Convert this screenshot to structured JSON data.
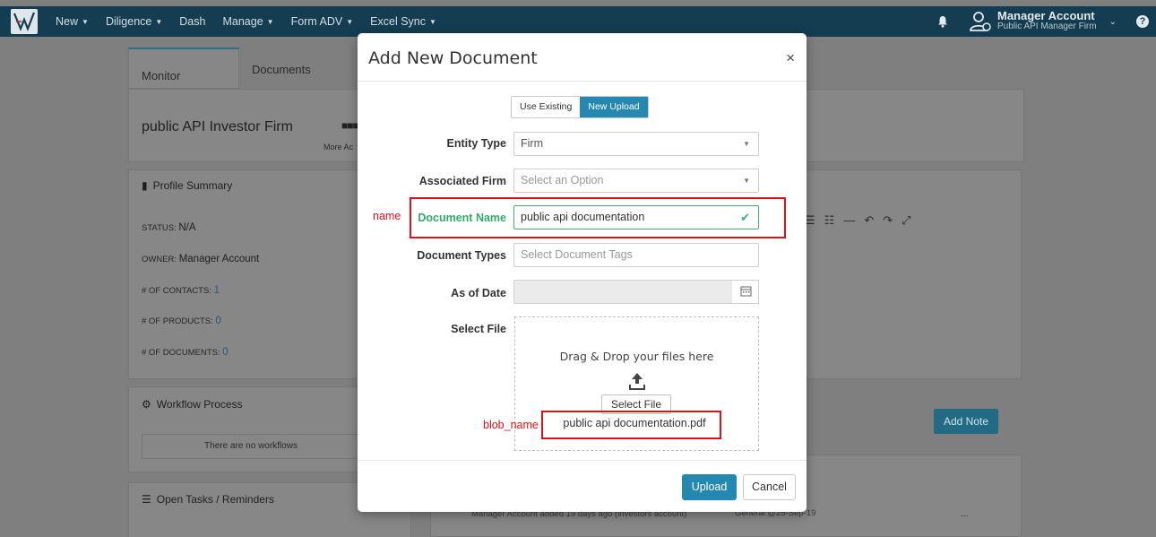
{
  "nav": {
    "items": [
      {
        "label": "New",
        "caret": true
      },
      {
        "label": "Diligence",
        "caret": true
      },
      {
        "label": "Dash",
        "caret": false
      },
      {
        "label": "Manage",
        "caret": true
      },
      {
        "label": "Form ADV",
        "caret": true
      },
      {
        "label": "Excel Sync",
        "caret": true
      }
    ],
    "account_name": "Manager Account",
    "account_firm": "Public API Manager Firm"
  },
  "background": {
    "tab_monitor": "Monitor",
    "tab_documents": "Documents",
    "firm_name": "public API Investor Firm",
    "more_actions": "More Ac",
    "profile_summary": "Profile Summary",
    "status_label": "STATUS:",
    "status_value": "N/A",
    "owner_label": "OWNER:",
    "owner_value": "Manager Account",
    "contacts_label": "# OF CONTACTS:",
    "contacts_value": "1",
    "products_label": "# OF PRODUCTS:",
    "products_value": "0",
    "documents_label": "# OF DOCUMENTS:",
    "documents_value": "0",
    "workflow_title": "Workflow Process",
    "no_workflows": "There are no workflows",
    "tasks_title": "Open Tasks / Reminders",
    "add_note": "Add Note",
    "activity_text": "Manager Account added 19 days ago (investors account)",
    "activity_tag": "General @25-Sep-19",
    "activity_more": "..."
  },
  "modal": {
    "title": "Add New Document",
    "close": "×",
    "toggle_existing": "Use Existing",
    "toggle_new": "New Upload",
    "entity_type_label": "Entity Type",
    "entity_type_value": "Firm",
    "assoc_firm_label": "Associated Firm",
    "assoc_firm_placeholder": "Select an Option",
    "doc_name_label": "Document Name",
    "doc_name_value": "public api documentation",
    "doc_types_label": "Document Types",
    "doc_types_placeholder": "Select Document Tags",
    "as_of_label": "As of Date",
    "select_file_label": "Select File",
    "drop_text": "Drag & Drop your files here",
    "select_file_button": "Select File",
    "file_name": "public api documentation.pdf",
    "upload": "Upload",
    "cancel": "Cancel"
  },
  "annotations": {
    "name": "name",
    "blob_name": "blob_name",
    "color": "#e0101a"
  },
  "colors": {
    "navbar": "#143d52",
    "primary": "#2488b0",
    "success": "#32ab6b"
  }
}
